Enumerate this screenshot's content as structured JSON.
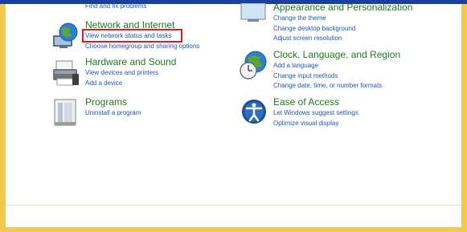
{
  "left_column": [
    {
      "id": "system-security-partial",
      "links": [
        "Find and fix problems"
      ]
    },
    {
      "id": "network",
      "title": "Network and Internet",
      "links": [
        "View network status and tasks",
        "Choose homegroup and sharing options"
      ]
    },
    {
      "id": "hardware",
      "title": "Hardware and Sound",
      "links": [
        "View devices and printers",
        "Add a device"
      ]
    },
    {
      "id": "programs",
      "title": "Programs",
      "links": [
        "Uninstall a program"
      ]
    }
  ],
  "right_column": [
    {
      "id": "appearance",
      "title": "Appearance and Personalization",
      "links": [
        "Change the theme",
        "Change desktop background",
        "Adjust screen resolution"
      ]
    },
    {
      "id": "clock",
      "title": "Clock, Language, and Region",
      "links": [
        "Add a language",
        "Change input methods",
        "Change date, time, or number formats"
      ]
    },
    {
      "id": "ease",
      "title": "Ease of Access",
      "links": [
        "Let Windows suggest settings",
        "Optimize visual display"
      ]
    }
  ],
  "colors": {
    "title": "#1d7a1d",
    "link": "#1e56b8",
    "highlight": "#d62020",
    "border": "#f2c94c",
    "top_bar": "#1a3f9c"
  },
  "icons": {
    "network": "network-globe-icon",
    "hardware": "printer-icon",
    "programs": "programs-box-icon",
    "appearance": "appearance-icon",
    "clock": "clock-globe-icon",
    "ease": "ease-of-access-icon"
  }
}
